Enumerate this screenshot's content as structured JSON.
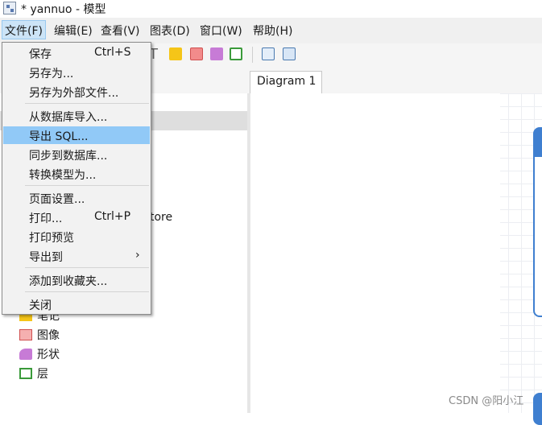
{
  "window": {
    "title": "* yannuo - 模型"
  },
  "menubar": [
    "文件(F)",
    "编辑(E)",
    "查看(V)",
    "图表(D)",
    "窗口(W)",
    "帮助(H)"
  ],
  "toolbar": {
    "text_tool": "T"
  },
  "tabs": {
    "diagram": "Diagram 1"
  },
  "file_menu": {
    "items": [
      {
        "label": "保存",
        "shortcut": "Ctrl+S"
      },
      {
        "label": "另存为..."
      },
      {
        "label": "另存为外部文件..."
      },
      {
        "label": "从数据库导入..."
      },
      {
        "label": "导出 SQL..."
      },
      {
        "label": "同步到数据库..."
      },
      {
        "label": "转换模型为..."
      },
      {
        "label": "页面设置..."
      },
      {
        "label": "打印...",
        "shortcut": "Ctrl+P"
      },
      {
        "label": "打印预览"
      },
      {
        "label": "导出到",
        "submenu": "›"
      },
      {
        "label": "添加到收藏夹..."
      },
      {
        "label": "关闭"
      }
    ]
  },
  "left_panel": {
    "partial_item_text": "tore",
    "tree": [
      {
        "label": "笔记",
        "icon": "note-icon"
      },
      {
        "label": "图像",
        "icon": "image-icon"
      },
      {
        "label": "形状",
        "icon": "shape-icon"
      },
      {
        "label": "层",
        "icon": "layer-icon"
      }
    ]
  },
  "watermark": "CSDN @阳小江",
  "colors": {
    "accent": "#3f7fd0",
    "menu_highlight": "#91c9f7",
    "menu_active": "#cce4f7"
  }
}
